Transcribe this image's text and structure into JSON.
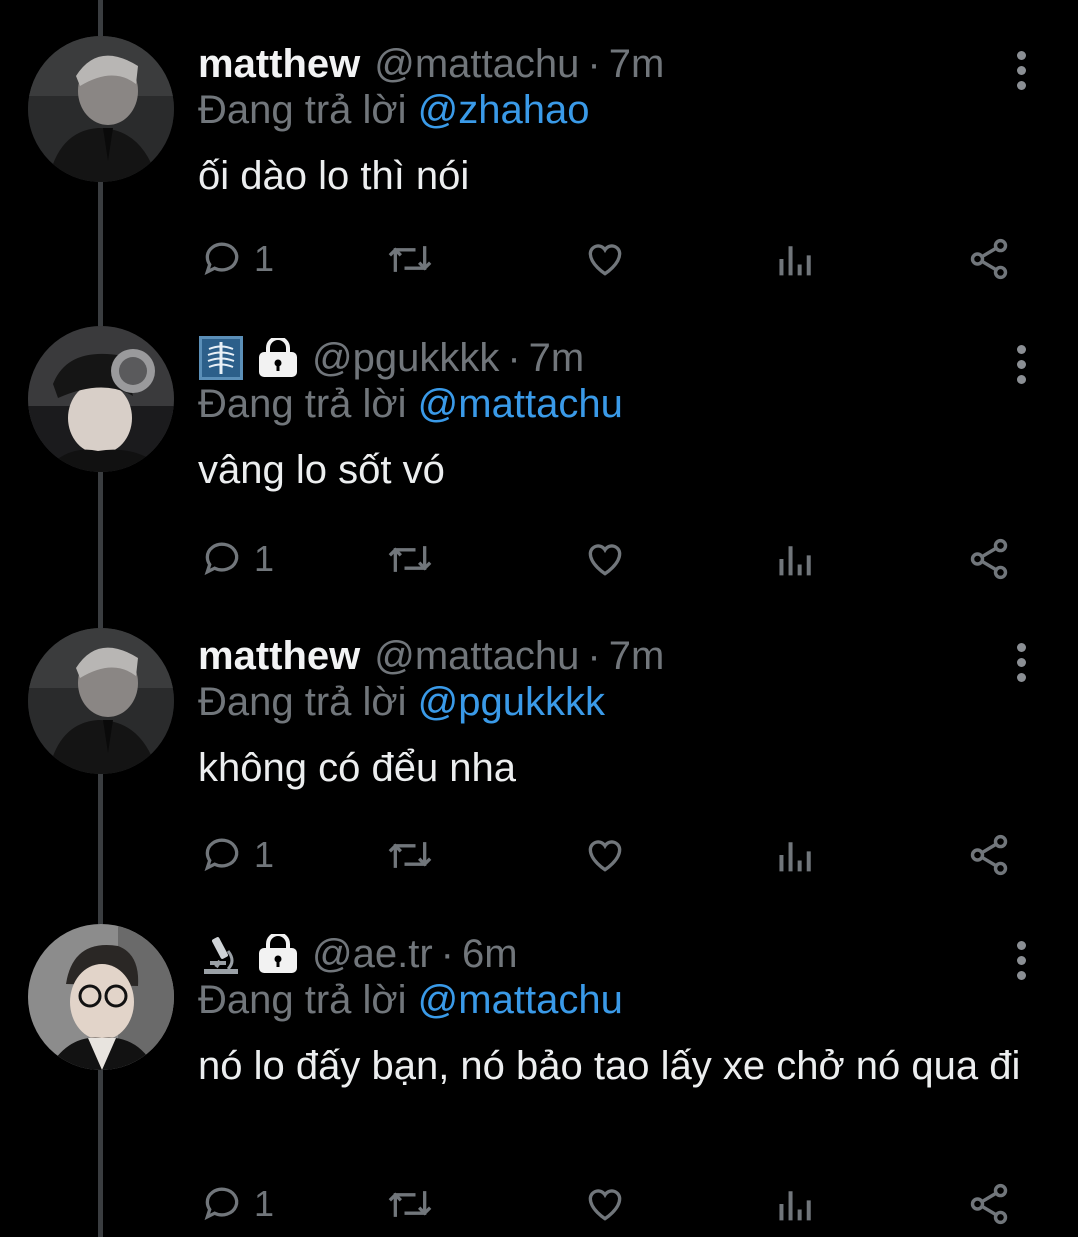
{
  "tweets": [
    {
      "display_name": "matthew",
      "show_display_name": true,
      "badges": [],
      "handle": "@mattachu",
      "separator": "·",
      "time": "7m",
      "replying_prefix": "Đang trả lời",
      "replying_to": "@zhahao",
      "text": "ối dào lo thì nói",
      "reply_count": "1",
      "avatar": "photo of man in black leather jacket"
    },
    {
      "display_name": "",
      "show_display_name": false,
      "badges": [
        "x-ray-icon",
        "lock-icon"
      ],
      "handle": "@pgukkkk",
      "separator": "·",
      "time": "7m",
      "replying_prefix": "Đang trả lời",
      "replying_to": "@mattachu",
      "text": "vâng lo sốt vó",
      "reply_count": "1",
      "avatar": "photo of person with headphones and cap"
    },
    {
      "display_name": "matthew",
      "show_display_name": true,
      "badges": [],
      "handle": "@mattachu",
      "separator": "·",
      "time": "7m",
      "replying_prefix": "Đang trả lời",
      "replying_to": "@pgukkkk",
      "text": "không có đểu nha",
      "reply_count": "1",
      "avatar": "photo of man in black leather jacket"
    },
    {
      "display_name": "",
      "show_display_name": false,
      "badges": [
        "microscope-icon",
        "lock-icon"
      ],
      "handle": "@ae.tr",
      "separator": "·",
      "time": "6m",
      "replying_prefix": "Đang trả lời",
      "replying_to": "@mattachu",
      "text": "nó lo đấy bạn, nó bảo tao lấy xe chở nó qua đi",
      "reply_count": "1",
      "avatar": "photo of person with glasses"
    }
  ],
  "colors": {
    "background": "#000000",
    "text": "#e7e9ea",
    "muted": "#71767b",
    "link": "#3a9ae8",
    "thread_line": "#3a3d40"
  }
}
